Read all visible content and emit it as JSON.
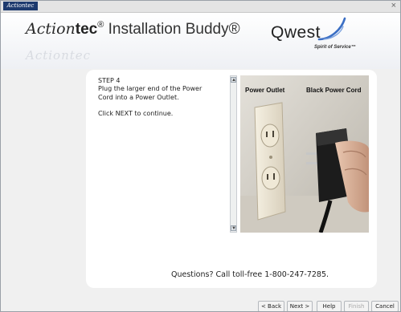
{
  "titlebar": {
    "logo_text": "Actiontec",
    "close_glyph": "×"
  },
  "header": {
    "brand_a": "Action",
    "brand_tec": "tec",
    "brand_reg": "®",
    "brand_ib": " Installation Buddy®",
    "brand_shadow": "Actiontec",
    "partner_word": "Qwest",
    "partner_tag": "Spirit of Service™"
  },
  "step": {
    "title": "STEP 4",
    "line1": "Plug the larger end of the Power",
    "line2": "Cord into a Power Outlet.",
    "line3": "Click NEXT to continue."
  },
  "photo": {
    "label_outlet": "Power Outlet",
    "label_cord": "Black Power Cord"
  },
  "scroll": {
    "up_glyph": "▲",
    "down_glyph": "▼"
  },
  "support": {
    "text": "Questions? Call toll-free 1-800-247-7285."
  },
  "buttons": {
    "back": "< Back",
    "next": "Next >",
    "help": "Help",
    "finish": "Finish",
    "cancel": "Cancel"
  }
}
